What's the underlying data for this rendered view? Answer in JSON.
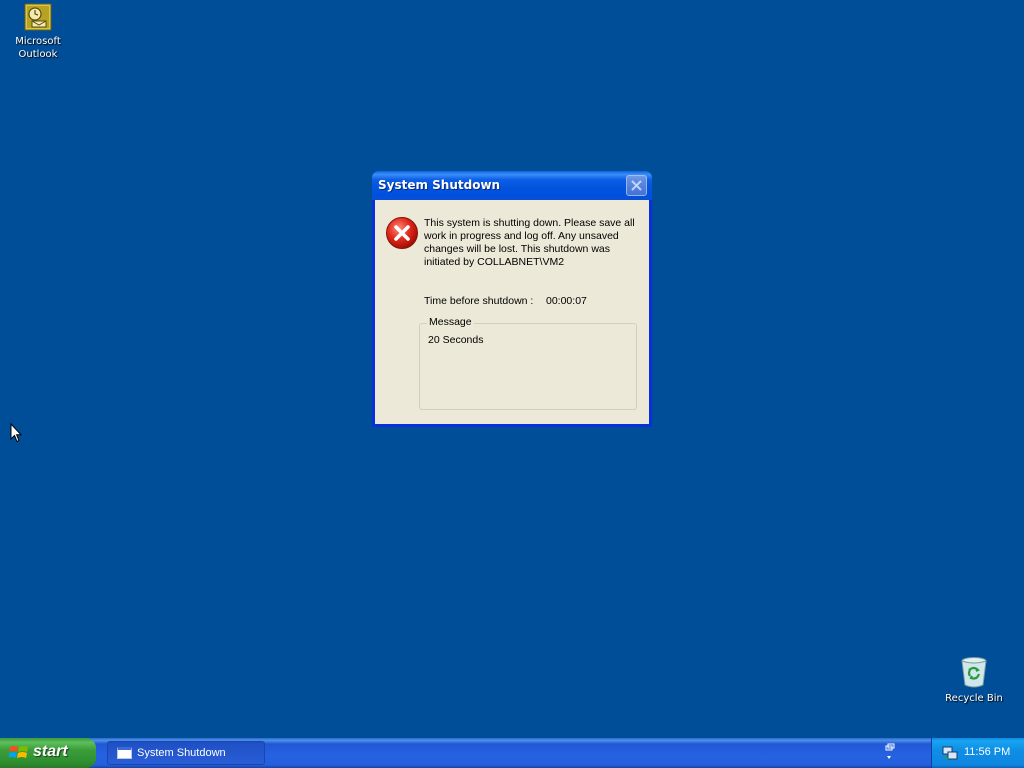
{
  "desktop": {
    "background_color": "#004e98",
    "icons": [
      {
        "label_line1": "Microsoft",
        "label_line2": "Outlook",
        "icon": "outlook-icon"
      },
      {
        "label_line1": "Recycle Bin",
        "label_line2": "",
        "icon": "recycle-bin-icon"
      }
    ]
  },
  "dialog": {
    "title": "System Shutdown",
    "icon": "error-icon",
    "close_icon": "close-icon",
    "message_lines": [
      "This system is shutting down. Please save all",
      "work in progress and log off. Any unsaved",
      "changes will be lost. This shutdown was",
      "initiated by COLLABNET\\VM2"
    ],
    "timer_label": "Time before shutdown :",
    "timer_value": "00:00:07",
    "message_group_label": "Message",
    "message_text": "20 Seconds"
  },
  "taskbar": {
    "start_label": "start",
    "tasks": [
      {
        "label": "System Shutdown",
        "icon": "window-icon"
      }
    ],
    "clock": "11:56 PM"
  }
}
